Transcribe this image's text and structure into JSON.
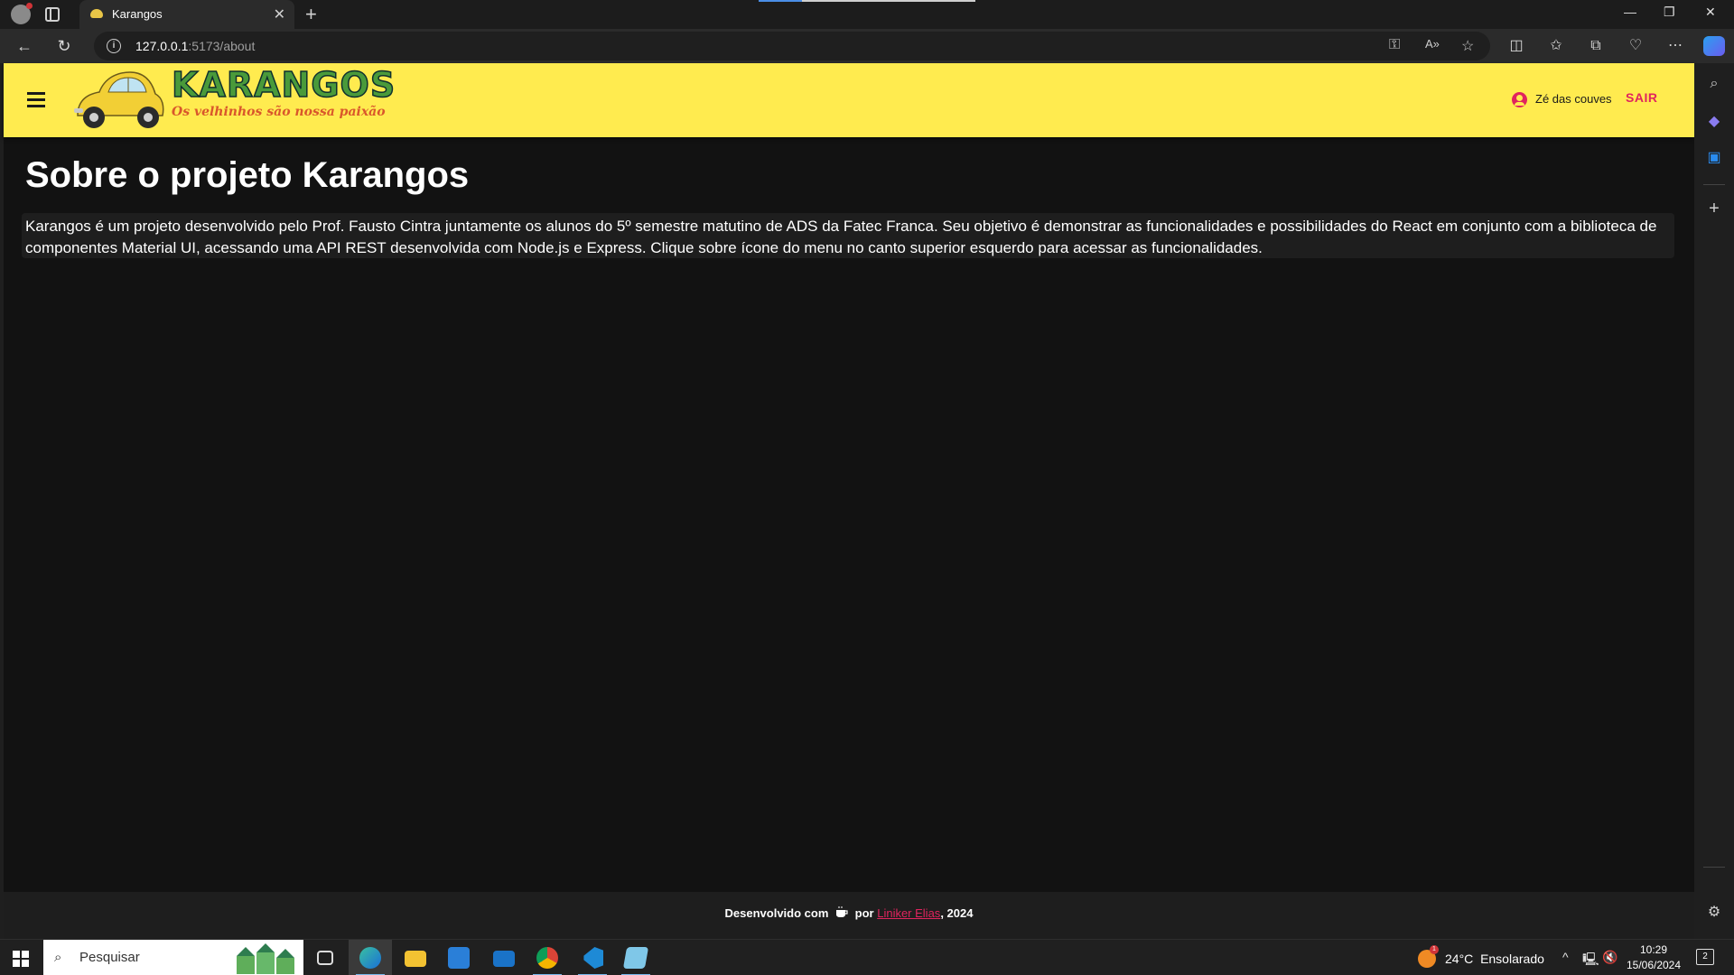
{
  "browser": {
    "tab_title": "Karangos",
    "tab_close": "✕",
    "new_tab": "+",
    "url_host": "127.0.0.1",
    "url_path": ":5173/about",
    "window_controls": [
      "—",
      "❐",
      "✕"
    ]
  },
  "app": {
    "logo_title": "KARANGOS",
    "logo_tagline": "Os velhinhos são nossa paixão",
    "user_name": "Zé das couves",
    "logout_label": "SAIR",
    "accent_color": "#ffeb4f",
    "link_color": "#e0245e"
  },
  "page": {
    "title": "Sobre o projeto Karangos",
    "body": "Karangos é um projeto desenvolvido pelo Prof. Fausto Cintra juntamente os alunos do 5º semestre matutino de ADS da Fatec Franca. Seu objetivo é demonstrar as funcionalidades e possibilidades do React em conjunto com a biblioteca de componentes Material UI, acessando uma API REST desenvolvida com Node.js e Express. Clique sobre ícone do menu no canto superior esquerdo para acessar as funcionalidades."
  },
  "footer": {
    "prefix": "Desenvolvido com",
    "by": "por",
    "author": "Liniker Elias",
    "suffix": ", 2024"
  },
  "taskbar": {
    "search_placeholder": "Pesquisar",
    "weather_temp": "24°C",
    "weather_desc": "Ensolarado",
    "weather_badge": "1",
    "time": "10:29",
    "date": "15/06/2024",
    "notification_count": "2"
  }
}
